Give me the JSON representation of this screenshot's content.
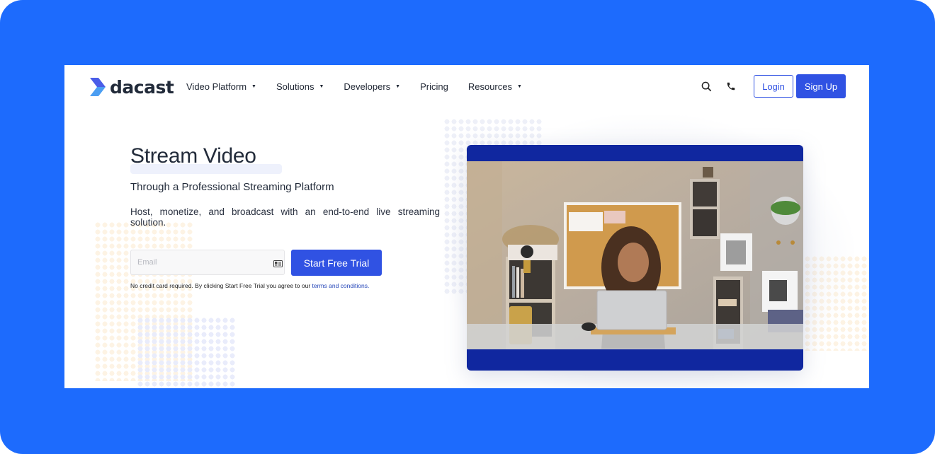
{
  "colors": {
    "frame_bg": "#1d6bfd",
    "brand_blue": "#3052e3",
    "video_bar": "#10279f",
    "text_dark": "#222b3a"
  },
  "header": {
    "logo_text": "dacast",
    "nav": [
      {
        "label": "Video Platform",
        "has_dropdown": true
      },
      {
        "label": "Solutions",
        "has_dropdown": true
      },
      {
        "label": "Developers",
        "has_dropdown": true
      },
      {
        "label": "Pricing",
        "has_dropdown": false
      },
      {
        "label": "Resources",
        "has_dropdown": true
      }
    ],
    "icons": [
      "search-icon",
      "phone-icon"
    ],
    "login_label": "Login",
    "signup_label": "Sign Up"
  },
  "hero": {
    "title": "Stream Video",
    "subtitle": "Through a Professional Streaming Platform",
    "description": "Host, monetize, and broadcast with an end-to-end live streaming solution.",
    "email_placeholder": "Email",
    "email_value": "",
    "cta_label": "Start Free Trial",
    "disclaimer_text": "No credit card required. By clicking Start Free Trial you agree to our ",
    "disclaimer_link": "terms and conditions."
  },
  "video": {
    "scene": "woman smiling at laptop in home office"
  }
}
